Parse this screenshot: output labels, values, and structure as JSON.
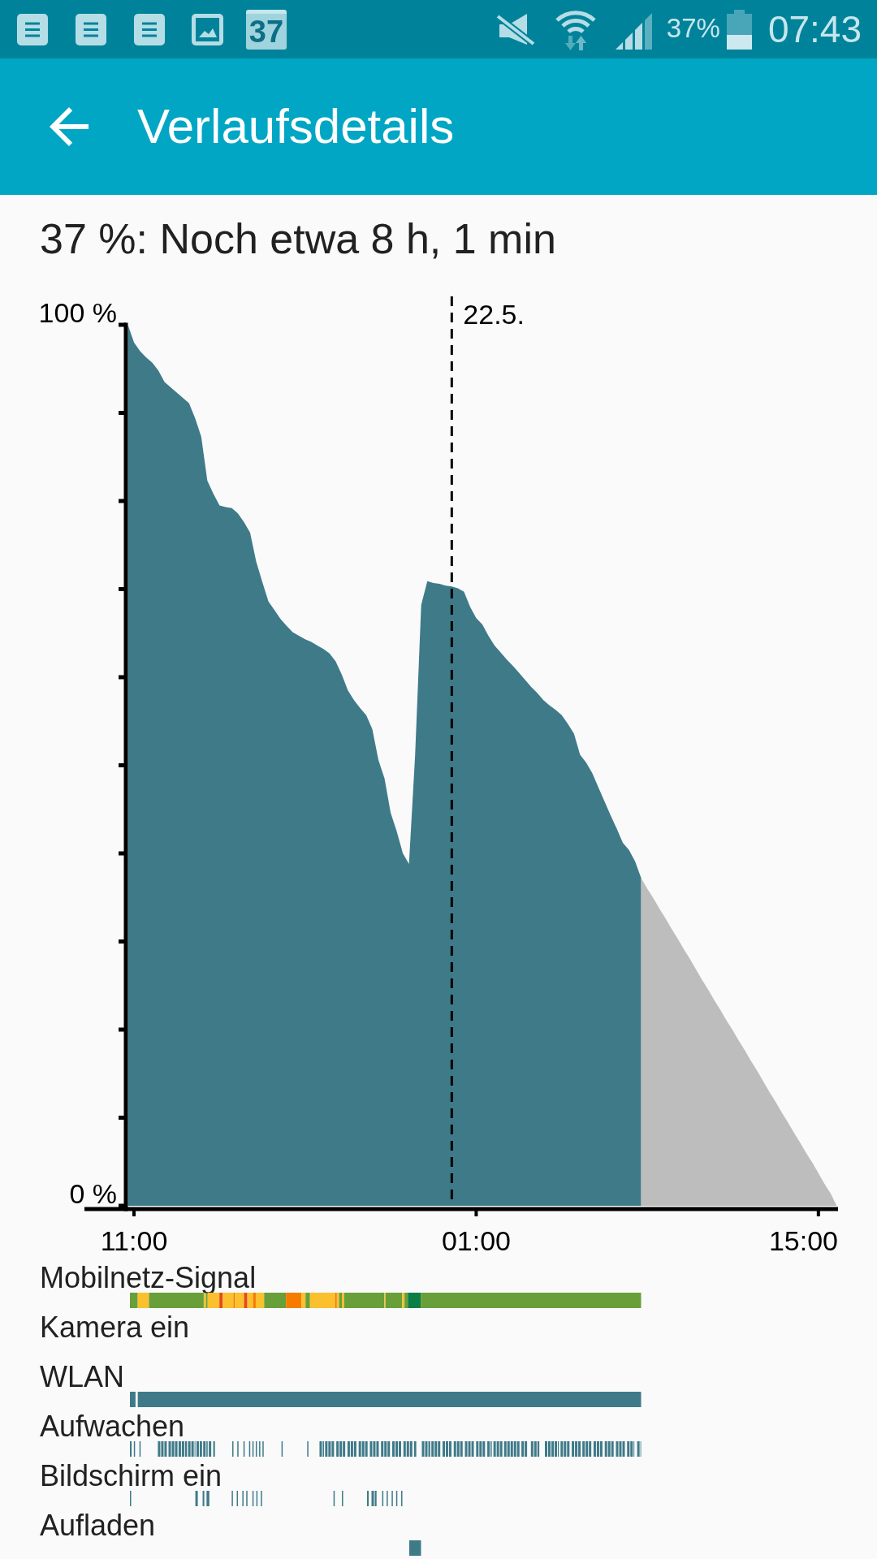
{
  "status_bar": {
    "calendar_date": "37",
    "battery_text": "37%",
    "time": "07:43"
  },
  "app_bar": {
    "title": "Verlaufsdetails"
  },
  "summary": "37 %: Noch etwa 8 h, 1 min",
  "chart": {
    "chart_data": {
      "type": "area",
      "categories": [
        null,
        "11:00",
        null,
        null,
        null,
        null,
        null,
        null,
        null,
        null,
        null,
        null,
        null,
        null,
        null,
        null,
        null,
        null,
        null,
        null,
        null,
        null,
        null,
        null,
        null,
        null,
        null,
        null,
        null,
        null,
        null,
        null,
        null,
        null,
        null,
        null,
        null,
        null,
        null,
        null,
        null,
        null,
        null,
        null,
        null,
        null,
        null,
        null,
        null,
        null,
        null,
        null,
        null,
        null,
        null,
        null,
        null,
        "01:00",
        null,
        null,
        null,
        null,
        null,
        null,
        null,
        null,
        null,
        null,
        null,
        null,
        null,
        null,
        null,
        null,
        null,
        null,
        null,
        null,
        null,
        null,
        null,
        null,
        null,
        null,
        null,
        null,
        null,
        null,
        null,
        null,
        null,
        null,
        null,
        null,
        null,
        null,
        null,
        null,
        null,
        null,
        null,
        null,
        null,
        null,
        null,
        null,
        null,
        null,
        null,
        null,
        null,
        null,
        null,
        "15:00",
        null,
        null,
        null
      ],
      "series": [
        {
          "color": "#3f7a89",
          "values": [
            100,
            98,
            97,
            96.3,
            95.7,
            94.8,
            93.5,
            92.9,
            92.3,
            91.7,
            91.1,
            89.4,
            87.3,
            82.3,
            80.8,
            79.5,
            79.3,
            79.2,
            78.6,
            77.6,
            76.4,
            73.1,
            70.8,
            68.6,
            67.6,
            66.6,
            65.8,
            65.1,
            64.7,
            64.3,
            64,
            63.6,
            63.2,
            62.7,
            61.8,
            60.3,
            58.5,
            57.4,
            56.5,
            55.7,
            54.1,
            50.6,
            48.5,
            44.6,
            42.5,
            40,
            38.8,
            51.1,
            68.2,
            70.9,
            70.7,
            70.6,
            70.4,
            70.3,
            70.1,
            69.7,
            68,
            66.7,
            66,
            64.7,
            63.6,
            62.8,
            62,
            61.3,
            60.5,
            59.7,
            58.9,
            58.2,
            57.4,
            56.8,
            56.3,
            55.7,
            54.7,
            53.6,
            51.2,
            50.3,
            49.1,
            47.5,
            45.9,
            44.3,
            42.8,
            41.2,
            40.4,
            39.1,
            37.2,
            null,
            null,
            null,
            null,
            null,
            null,
            null,
            null,
            null,
            null,
            null,
            null,
            null,
            null,
            null,
            null,
            null,
            null,
            null,
            null,
            null,
            null,
            null,
            null,
            null,
            null,
            null,
            null,
            null,
            null,
            null,
            null
          ]
        },
        {
          "color": "#bdbdbd",
          "values": [
            null,
            null,
            null,
            null,
            null,
            null,
            null,
            null,
            null,
            null,
            null,
            null,
            null,
            null,
            null,
            null,
            null,
            null,
            null,
            null,
            null,
            null,
            null,
            null,
            null,
            null,
            null,
            null,
            null,
            null,
            null,
            null,
            null,
            null,
            null,
            null,
            null,
            null,
            null,
            null,
            null,
            null,
            null,
            null,
            null,
            null,
            null,
            null,
            null,
            null,
            null,
            null,
            null,
            null,
            null,
            null,
            null,
            null,
            null,
            null,
            null,
            null,
            null,
            null,
            null,
            null,
            null,
            null,
            null,
            null,
            null,
            null,
            null,
            null,
            null,
            null,
            null,
            null,
            null,
            null,
            null,
            null,
            null,
            null,
            37.2,
            36,
            34.9,
            33.7,
            32.6,
            31.4,
            30.3,
            29.1,
            28,
            26.8,
            25.6,
            24.5,
            23.3,
            22.2,
            21,
            19.9,
            18.7,
            17.6,
            16.4,
            15.3,
            14.1,
            12.9,
            11.8,
            10.6,
            9.5,
            8.3,
            7.2,
            6,
            4.9,
            3.7,
            2.5,
            1.4,
            0
          ]
        }
      ],
      "ylim": [
        0,
        100
      ],
      "yticks": [
        {
          "value": 100,
          "label": "100 %"
        },
        {
          "value": 0,
          "label": "0 %"
        }
      ],
      "annotations": [
        "22.5."
      ]
    }
  },
  "event_rows": [
    {
      "label": "Mobilnetz-Signal",
      "kind": "signal"
    },
    {
      "label": "Kamera ein",
      "kind": "empty"
    },
    {
      "label": "WLAN",
      "kind": "solid"
    },
    {
      "label": "Aufwachen",
      "kind": "wake"
    },
    {
      "label": "Bildschirm ein",
      "kind": "screen"
    },
    {
      "label": "Aufladen",
      "kind": "charging"
    }
  ]
}
